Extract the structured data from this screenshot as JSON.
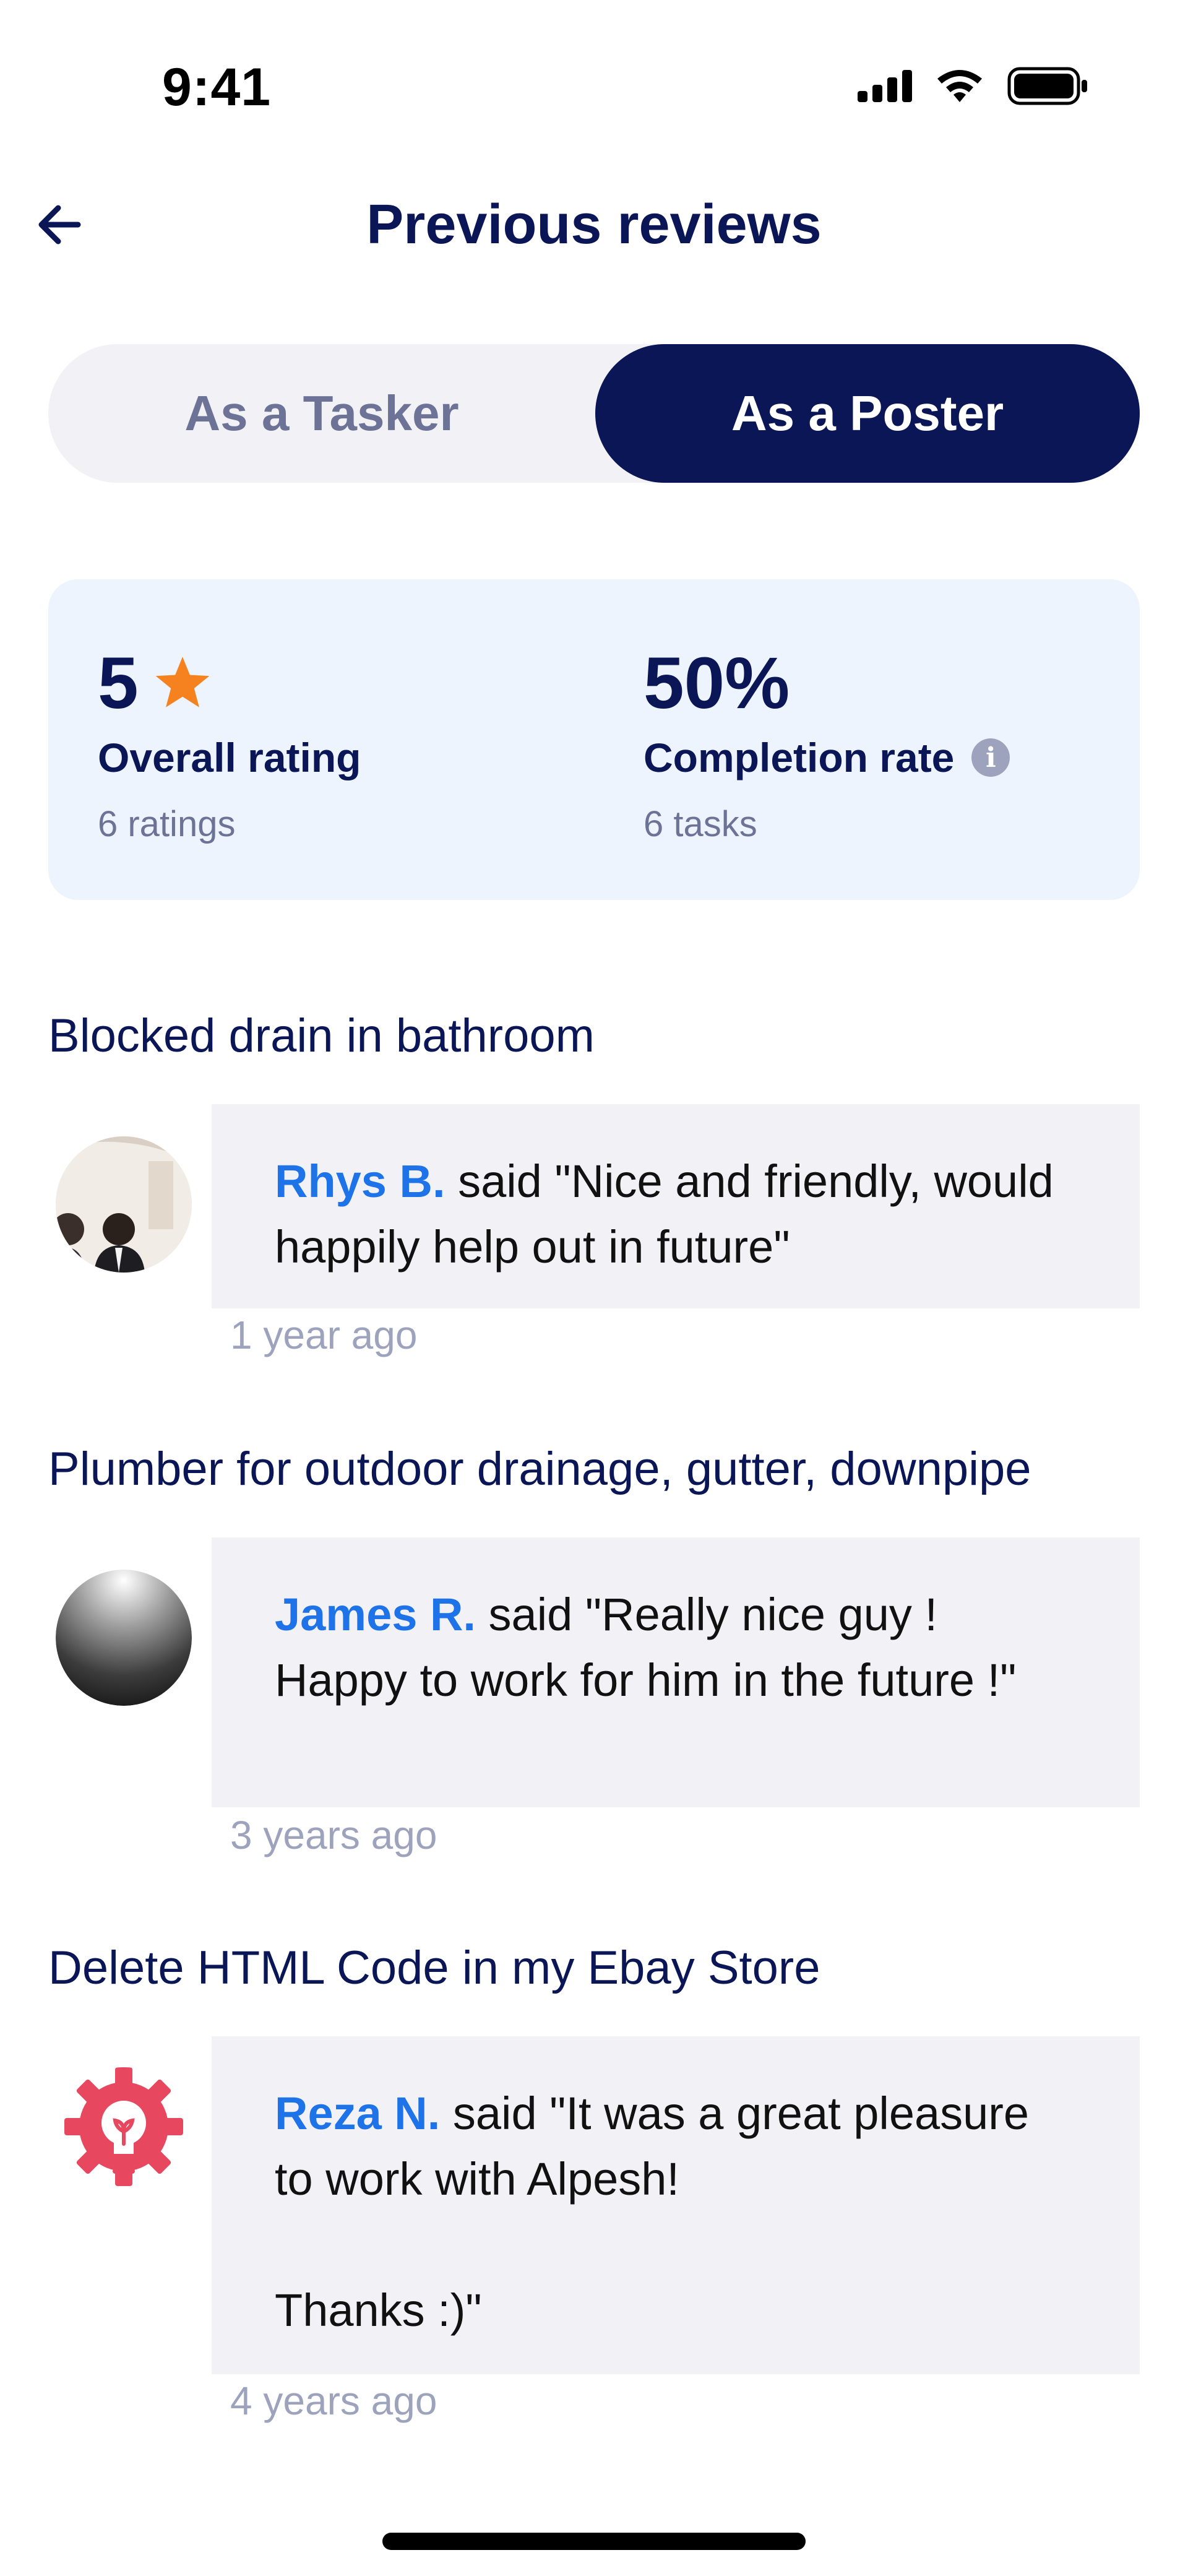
{
  "status_bar": {
    "time": "9:41"
  },
  "header": {
    "title": "Previous reviews"
  },
  "tabs": [
    {
      "label": "As a Tasker",
      "selected": false
    },
    {
      "label": "As a Poster",
      "selected": true
    }
  ],
  "stats": {
    "rating": {
      "value": "5",
      "label": "Overall rating",
      "sub": "6 ratings"
    },
    "completion": {
      "value": "50%",
      "label": "Completion rate",
      "sub": "6 tasks"
    }
  },
  "reviews": [
    {
      "task_title": "Blocked drain in bathroom",
      "reviewer": "Rhys B.",
      "text": " said \"Nice and friendly, would happily help out in future\"",
      "time": "1 year ago"
    },
    {
      "task_title": "Plumber for outdoor drainage, gutter, downpipe",
      "reviewer": "James R.",
      "text": " said \"Really nice guy ! Happy to work for him in the future !\"",
      "time": "3 years ago"
    },
    {
      "task_title": "Delete HTML Code in my Ebay Store",
      "reviewer": "Reza N.",
      "text": " said \"It was a great pleasure to work with Alpesh!\n\nThanks :)\"",
      "time": "4 years ago"
    }
  ],
  "colors": {
    "navy": "#0b1657",
    "accent_blue": "#1e73e8",
    "star": "#f5811f",
    "muted": "#9ea3bd",
    "card_bg": "#eef4fd",
    "bubble_bg": "#f2f2f6",
    "logo_red": "#e8485f"
  },
  "icons": {
    "back": "arrow-left-icon",
    "star": "star-icon",
    "info": "info-icon",
    "signal": "cellular-signal-icon",
    "wifi": "wifi-icon",
    "battery": "battery-icon"
  }
}
